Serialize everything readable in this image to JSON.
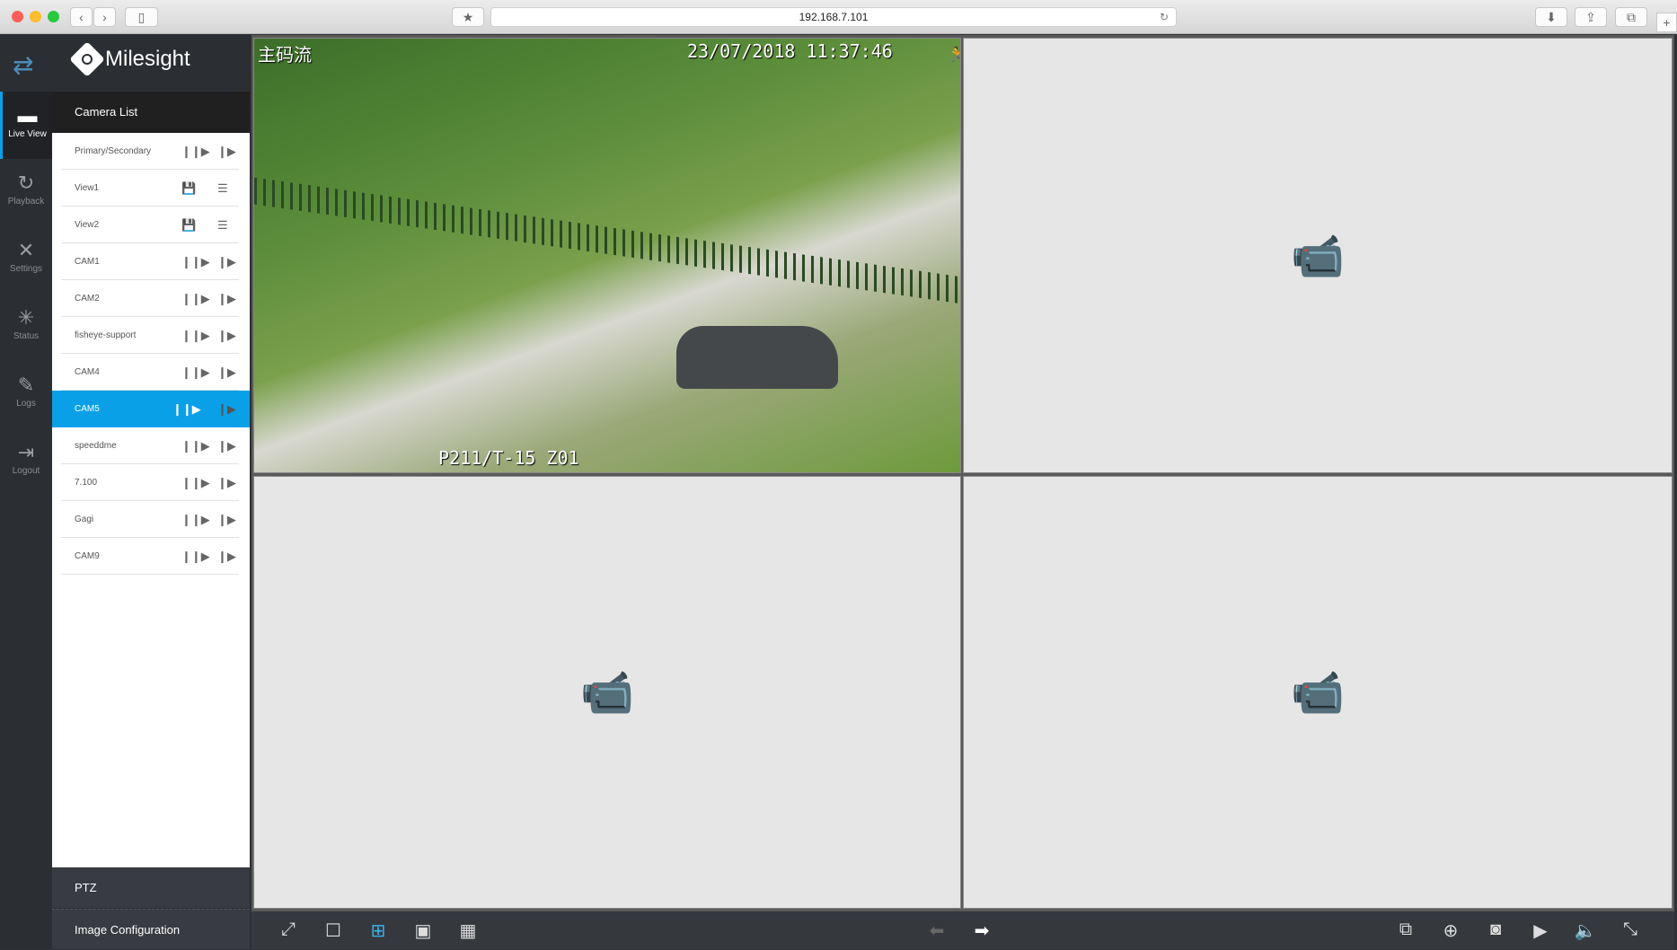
{
  "browser": {
    "url": "192.168.7.101"
  },
  "brand": {
    "name": "Milesight",
    "accent": "#0aa0e8"
  },
  "rail": [
    {
      "label": "Live View",
      "icon": "live-view-icon",
      "active": true
    },
    {
      "label": "Playback",
      "icon": "playback-icon"
    },
    {
      "label": "Settings",
      "icon": "settings-icon"
    },
    {
      "label": "Status",
      "icon": "status-icon"
    },
    {
      "label": "Logs",
      "icon": "logs-icon"
    },
    {
      "label": "Logout",
      "icon": "logout-icon"
    }
  ],
  "camera_list": {
    "title": "Camera List",
    "items": [
      {
        "label": "Primary/Secondary",
        "type": "stream"
      },
      {
        "label": "View1",
        "type": "view"
      },
      {
        "label": "View2",
        "type": "view"
      },
      {
        "label": "CAM1",
        "type": "stream"
      },
      {
        "label": "CAM2",
        "type": "stream"
      },
      {
        "label": "fisheye-support",
        "type": "stream"
      },
      {
        "label": "CAM4",
        "type": "stream"
      },
      {
        "label": "CAM5",
        "type": "stream",
        "selected": true
      },
      {
        "label": "speeddme",
        "type": "stream"
      },
      {
        "label": "7.100",
        "type": "stream"
      },
      {
        "label": "Gagi",
        "type": "stream"
      },
      {
        "label": "CAM9",
        "type": "stream"
      }
    ]
  },
  "sections": {
    "ptz": "PTZ",
    "image_config": "Image Configuration"
  },
  "video": {
    "stream_label": "主码流",
    "timestamp": "23/07/2018 11:37:46",
    "ptz_info": "P211/T-15 Z01"
  },
  "toolbar": {
    "layout_selected": "4-split"
  }
}
